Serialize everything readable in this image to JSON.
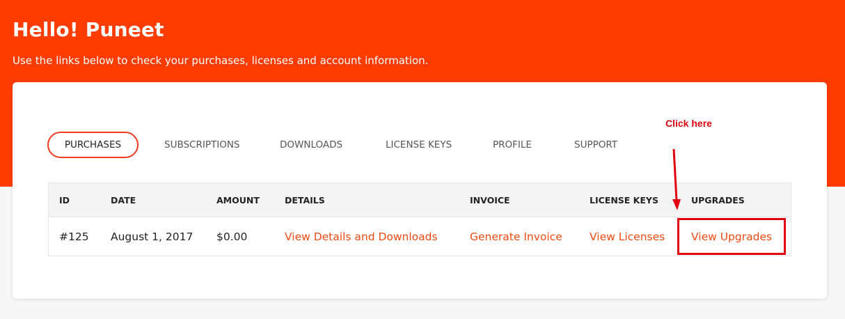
{
  "greeting": "Hello! Puneet",
  "subtitle": "Use the links below to check your purchases, licenses and account information.",
  "tabs": [
    {
      "label": "PURCHASES",
      "active": true
    },
    {
      "label": "SUBSCRIPTIONS",
      "active": false
    },
    {
      "label": "DOWNLOADS",
      "active": false
    },
    {
      "label": "LICENSE KEYS",
      "active": false
    },
    {
      "label": "PROFILE",
      "active": false
    },
    {
      "label": "SUPPORT",
      "active": false
    }
  ],
  "table": {
    "headers": [
      "ID",
      "DATE",
      "AMOUNT",
      "DETAILS",
      "INVOICE",
      "LICENSE KEYS",
      "UPGRADES"
    ],
    "rows": [
      {
        "id": "#125",
        "date": "August 1, 2017",
        "amount": "$0.00",
        "details": "View Details and Downloads",
        "invoice": "Generate Invoice",
        "license_keys": "View Licenses",
        "upgrades": "View Upgrades"
      }
    ]
  },
  "annotation": {
    "text": "Click here",
    "color": "#e0000f"
  },
  "colors": {
    "brand": "#ff3c00",
    "link": "#f04a12",
    "active_tab_border": "#ef3b1f"
  }
}
